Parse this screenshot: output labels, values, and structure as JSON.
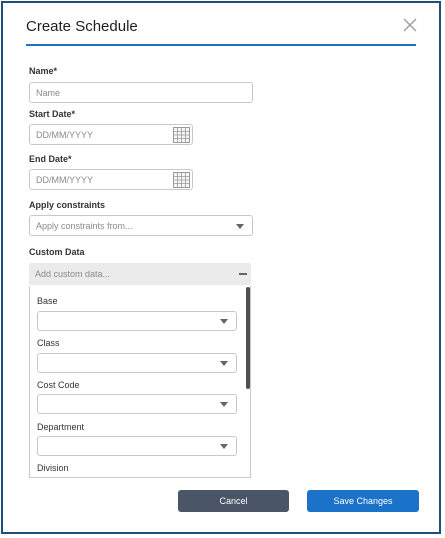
{
  "dialog": {
    "title": "Create Schedule",
    "close_icon": "close-icon"
  },
  "form": {
    "name": {
      "label": "Name*",
      "placeholder": "Name"
    },
    "start_date": {
      "label": "Start Date*",
      "placeholder": "DD/MM/YYYY",
      "icon": "calendar-icon"
    },
    "end_date": {
      "label": "End Date*",
      "placeholder": "DD/MM/YYYY",
      "icon": "calendar-icon"
    },
    "constraints": {
      "label": "Apply constraints",
      "placeholder": "Apply constraints from..."
    },
    "custom_data": {
      "label": "Custom Data",
      "placeholder": "Add custom data...",
      "fields": [
        {
          "label": "Base",
          "value": ""
        },
        {
          "label": "Class",
          "value": ""
        },
        {
          "label": "Cost Code",
          "value": ""
        },
        {
          "label": "Department",
          "value": ""
        },
        {
          "label": "Division",
          "value": ""
        }
      ]
    }
  },
  "buttons": {
    "cancel": "Cancel",
    "save": "Save Changes"
  },
  "colors": {
    "accent": "#1b72c9",
    "cancel_bg": "#4a5567",
    "border": "#1f4e79"
  }
}
